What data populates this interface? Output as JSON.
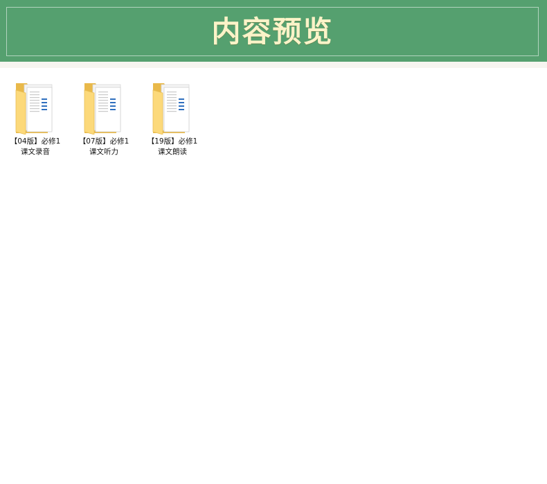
{
  "banner": {
    "title": "内容预览"
  },
  "colors": {
    "banner_bg": "#55a06f",
    "title_text": "#fbf3c8",
    "folder_yellow": "#fcd97a"
  },
  "folders": [
    {
      "line1": "【04版】必修1",
      "line2": "课文录音",
      "icon": "folder-icon"
    },
    {
      "line1": "【07版】必修1",
      "line2": "课文听力",
      "icon": "folder-icon"
    },
    {
      "line1": "【19版】必修1",
      "line2": "课文朗读",
      "icon": "folder-icon"
    }
  ]
}
